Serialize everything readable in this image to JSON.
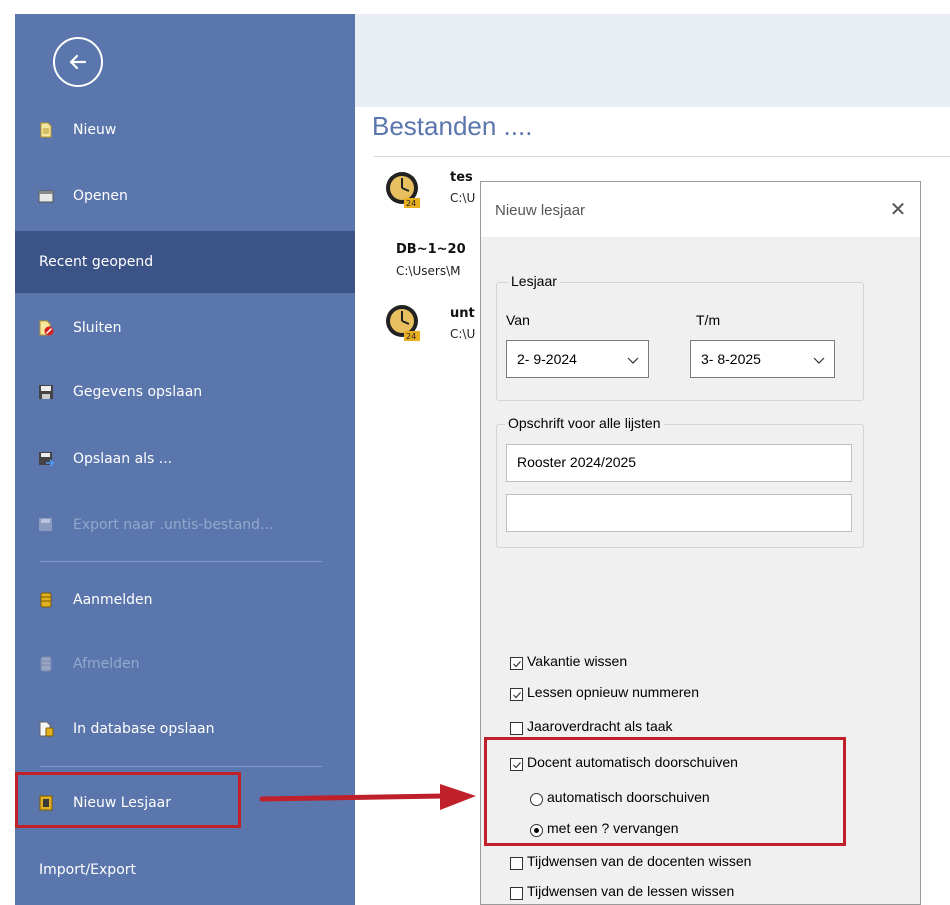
{
  "sidebar": {
    "items": [
      {
        "label": "Nieuw",
        "icon": "new-file-icon"
      },
      {
        "label": "Openen",
        "icon": "open-folder-icon"
      },
      {
        "label": "Recent geopend",
        "icon": ""
      },
      {
        "label": "Sluiten",
        "icon": "close-file-icon"
      },
      {
        "label": "Gegevens opslaan",
        "icon": "save-icon"
      },
      {
        "label": "Opslaan als ...",
        "icon": "save-as-icon"
      },
      {
        "label": "Export naar .untis-bestand...",
        "icon": "export-icon"
      },
      {
        "label": "Aanmelden",
        "icon": "database-icon"
      },
      {
        "label": "Afmelden",
        "icon": "database-icon"
      },
      {
        "label": "In database opslaan",
        "icon": "database-save-icon"
      },
      {
        "label": "Nieuw Lesjaar",
        "icon": "new-school-year-icon"
      },
      {
        "label": "Import/Export",
        "icon": ""
      }
    ]
  },
  "main": {
    "title": "Bestanden ....",
    "recent": [
      {
        "name": "tes",
        "path": "C:\\U"
      },
      {
        "name": "DB~1~20",
        "path": "C:\\Users\\M"
      },
      {
        "name": "unt",
        "path": "C:\\U"
      }
    ]
  },
  "dialog": {
    "title": "Nieuw lesjaar",
    "lesjaar_group": "Lesjaar",
    "van_label": "Van",
    "tm_label": "T/m",
    "van_value": "2- 9-2024",
    "tm_value": "3- 8-2025",
    "opschrift_group": "Opschrift voor alle lijsten",
    "opschrift_line1": "Rooster 2024/2025",
    "opschrift_line2": "",
    "checks": [
      {
        "label": "Vakantie wissen",
        "checked": true
      },
      {
        "label": "Lessen opnieuw nummeren",
        "checked": true
      },
      {
        "label": "Jaaroverdracht als taak",
        "checked": false
      },
      {
        "label": "Docent automatisch doorschuiven",
        "checked": true
      }
    ],
    "radios": [
      {
        "label": "automatisch doorschuiven",
        "selected": false
      },
      {
        "label": "met een ? vervangen",
        "selected": true
      }
    ],
    "checks2": [
      {
        "label": "Tijdwensen van de docenten wissen",
        "checked": false
      },
      {
        "label": "Tijdwensen van de lessen wissen",
        "checked": false
      }
    ]
  },
  "colors": {
    "sidebar": "#5a76ac",
    "sidebar_active": "#3c5387",
    "highlight": "#c0202a",
    "title": "#5a76ac"
  }
}
